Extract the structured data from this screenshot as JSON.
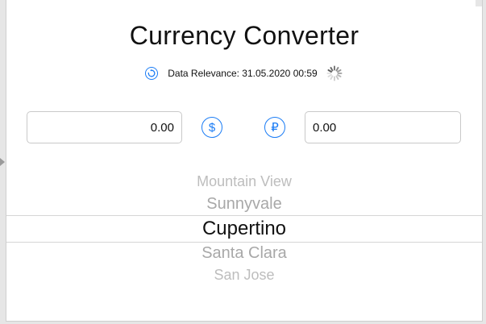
{
  "header": {
    "title": "Currency Converter"
  },
  "relevance": {
    "text": "Data Relevance: 31.05.2020 00:59"
  },
  "converter": {
    "from_value": "0.00",
    "to_value": "0.00",
    "from_symbol": "$",
    "to_symbol": "₽"
  },
  "picker": {
    "items": [
      "Mountain View",
      "Sunnyvale",
      "Cupertino",
      "Santa Clara",
      "San Jose"
    ],
    "selected": "Cupertino"
  },
  "colors": {
    "accent": "#1a7cf5",
    "muted_text": "#a8a8a8",
    "selected_text": "#111111"
  },
  "icons": {
    "refresh": "refresh-icon",
    "loading": "loading-spinner-icon"
  }
}
